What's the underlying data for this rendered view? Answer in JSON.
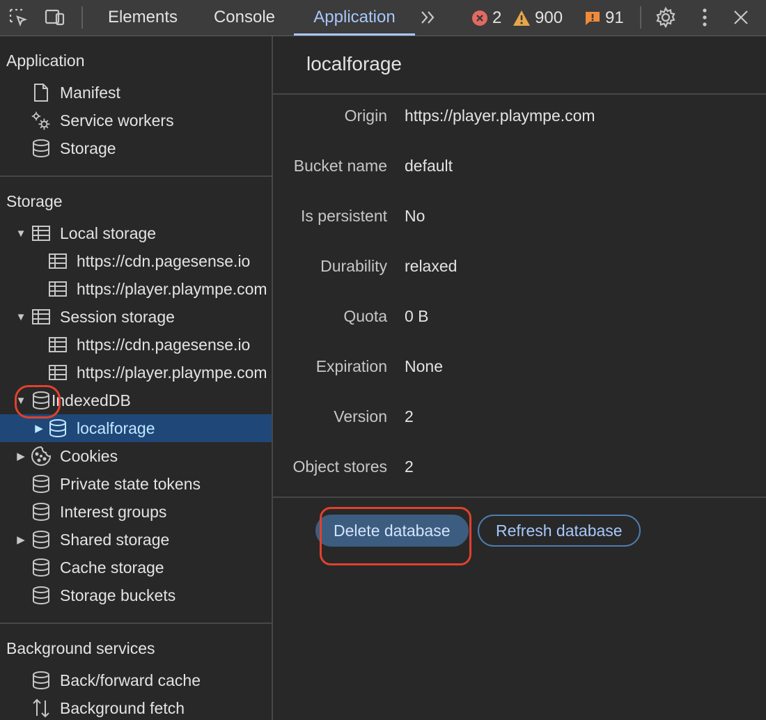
{
  "toolbar": {
    "tabs": [
      {
        "label": "Elements"
      },
      {
        "label": "Console"
      },
      {
        "label": "Application"
      }
    ],
    "more_tabs_icon": "double-chevron-icon",
    "errors": "2",
    "warnings": "900",
    "issues": "91",
    "colors": {
      "error": "#e46962",
      "warning": "#e8a64a",
      "issue": "#f08a3a",
      "accent": "#a8c7fa"
    }
  },
  "sidebar": {
    "application": {
      "heading": "Application",
      "items": [
        {
          "label": "Manifest",
          "icon": "document-icon"
        },
        {
          "label": "Service workers",
          "icon": "gears-icon"
        },
        {
          "label": "Storage",
          "icon": "database-icon"
        }
      ]
    },
    "storage": {
      "heading": "Storage",
      "local_storage": "Local storage",
      "local_children": [
        "https://cdn.pagesense.io",
        "https://player.plaympe.com"
      ],
      "session_storage": "Session storage",
      "session_children": [
        "https://cdn.pagesense.io",
        "https://player.plaympe.com"
      ],
      "indexeddb": "IndexedDB",
      "localforage": "localforage",
      "cookies": "Cookies",
      "private_state_tokens": "Private state tokens",
      "interest_groups": "Interest groups",
      "shared_storage": "Shared storage",
      "cache_storage": "Cache storage",
      "storage_buckets": "Storage buckets"
    },
    "background": {
      "heading": "Background services",
      "items": [
        {
          "label": "Back/forward cache",
          "icon": "database-icon"
        },
        {
          "label": "Background fetch",
          "icon": "up-down-arrows-icon"
        }
      ]
    }
  },
  "main": {
    "title": "localforage",
    "fields": [
      {
        "key": "Origin",
        "value": "https://player.plaympe.com"
      },
      {
        "key": "Bucket name",
        "value": "default"
      },
      {
        "key": "Is persistent",
        "value": "No"
      },
      {
        "key": "Durability",
        "value": "relaxed"
      },
      {
        "key": "Quota",
        "value": "0 B"
      },
      {
        "key": "Expiration",
        "value": "None"
      },
      {
        "key": "Version",
        "value": "2"
      },
      {
        "key": "Object stores",
        "value": "2"
      }
    ],
    "delete_label": "Delete database",
    "refresh_label": "Refresh database"
  }
}
